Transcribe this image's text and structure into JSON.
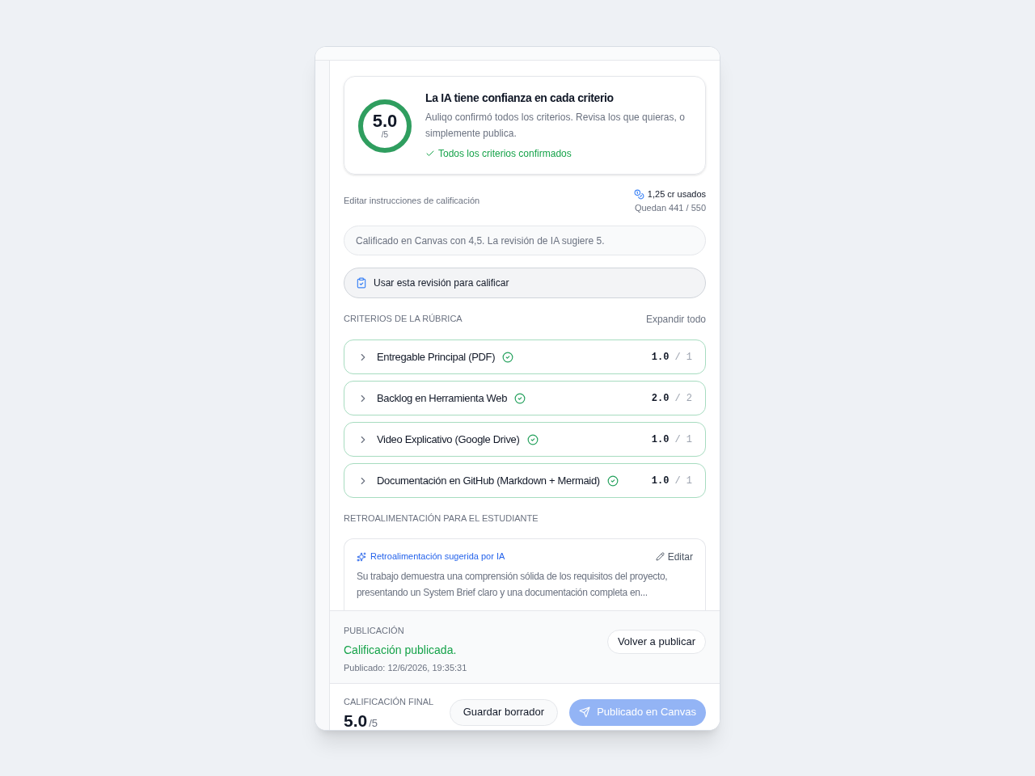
{
  "summary": {
    "score": "5.0",
    "out_of": "/5",
    "level": 1,
    "title": "La IA tiene confianza en cada criterio",
    "description": "Auliqo confirmó todos los criterios. Revisa los que quieras, o simplemente publica.",
    "status": "Todos los criterios confirmados"
  },
  "instructions_link": "Editar instrucciones de calificación",
  "credits": {
    "used": "1,25 cr usados",
    "remaining": "Quedan 441 / 550"
  },
  "canvas_note": "Calificado en Canvas con 4,5. La revisión de IA sugiere 5.",
  "use_review_button": "Usar esta revisión para calificar",
  "rubric": {
    "heading": "CRITERIOS DE LA RÚBRICA",
    "expand_all": "Expandir todo",
    "criteria": [
      {
        "name": "Entregable Principal (PDF)",
        "confirmed": true,
        "expanded": false,
        "score": "1.0",
        "max": "/ 1"
      },
      {
        "name": "Backlog en Herramienta Web",
        "confirmed": true,
        "expanded": false,
        "score": "2.0",
        "max": "/ 2"
      },
      {
        "name": "Video Explicativo (Google Drive)",
        "confirmed": true,
        "expanded": false,
        "score": "1.0",
        "max": "/ 1"
      },
      {
        "name": "Documentación en GitHub (Markdown + Mermaid)",
        "confirmed": true,
        "expanded": false,
        "score": "1.0",
        "max": "/ 1"
      }
    ]
  },
  "feedback": {
    "heading": "RETROALIMENTACIÓN PARA EL ESTUDIANTE",
    "label": "Retroalimentación sugerida por IA",
    "edit": "Editar",
    "text": "Su trabajo demuestra una comprensión sólida de los requisitos del proyecto, presentando un System Brief claro y una documentación completa en..."
  },
  "publication": {
    "heading": "PUBLICACIÓN",
    "status": "Calificación publicada.",
    "published_at": "Publicado: 12/6/2026, 19:35:31",
    "republish": "Volver a publicar"
  },
  "footer": {
    "label": "CALIFICACIÓN FINAL",
    "score": "5.0",
    "out_of": "/5",
    "save_draft": "Guardar borrador",
    "publish": "Publicado en Canvas",
    "publish_disabled": true
  }
}
